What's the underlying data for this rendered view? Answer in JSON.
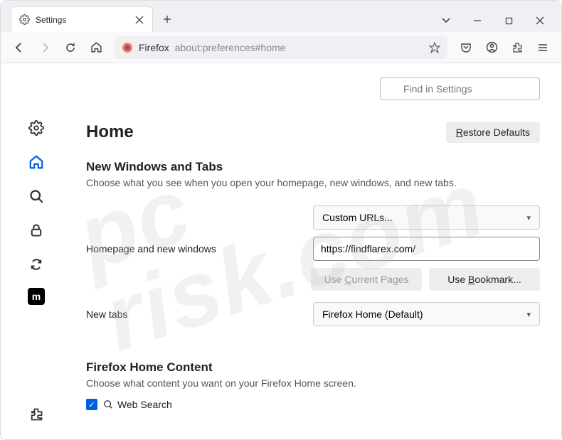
{
  "tab": {
    "title": "Settings"
  },
  "urlbar": {
    "label": "Firefox",
    "url": "about:preferences#home"
  },
  "search": {
    "placeholder": "Find in Settings"
  },
  "header": {
    "title": "Home",
    "restore": "Restore Defaults"
  },
  "section1": {
    "title": "New Windows and Tabs",
    "desc": "Choose what you see when you open your homepage, new windows, and new tabs.",
    "homepage_label": "Homepage and new windows",
    "homepage_select": "Custom URLs...",
    "homepage_url": "https://findflarex.com/",
    "use_current": "Use Current Pages",
    "use_bookmark": "Use Bookmark...",
    "newtabs_label": "New tabs",
    "newtabs_select": "Firefox Home (Default)"
  },
  "section2": {
    "title": "Firefox Home Content",
    "desc": "Choose what content you want on your Firefox Home screen.",
    "websearch": "Web Search"
  },
  "sidebar": {
    "ext_letter": "m"
  }
}
